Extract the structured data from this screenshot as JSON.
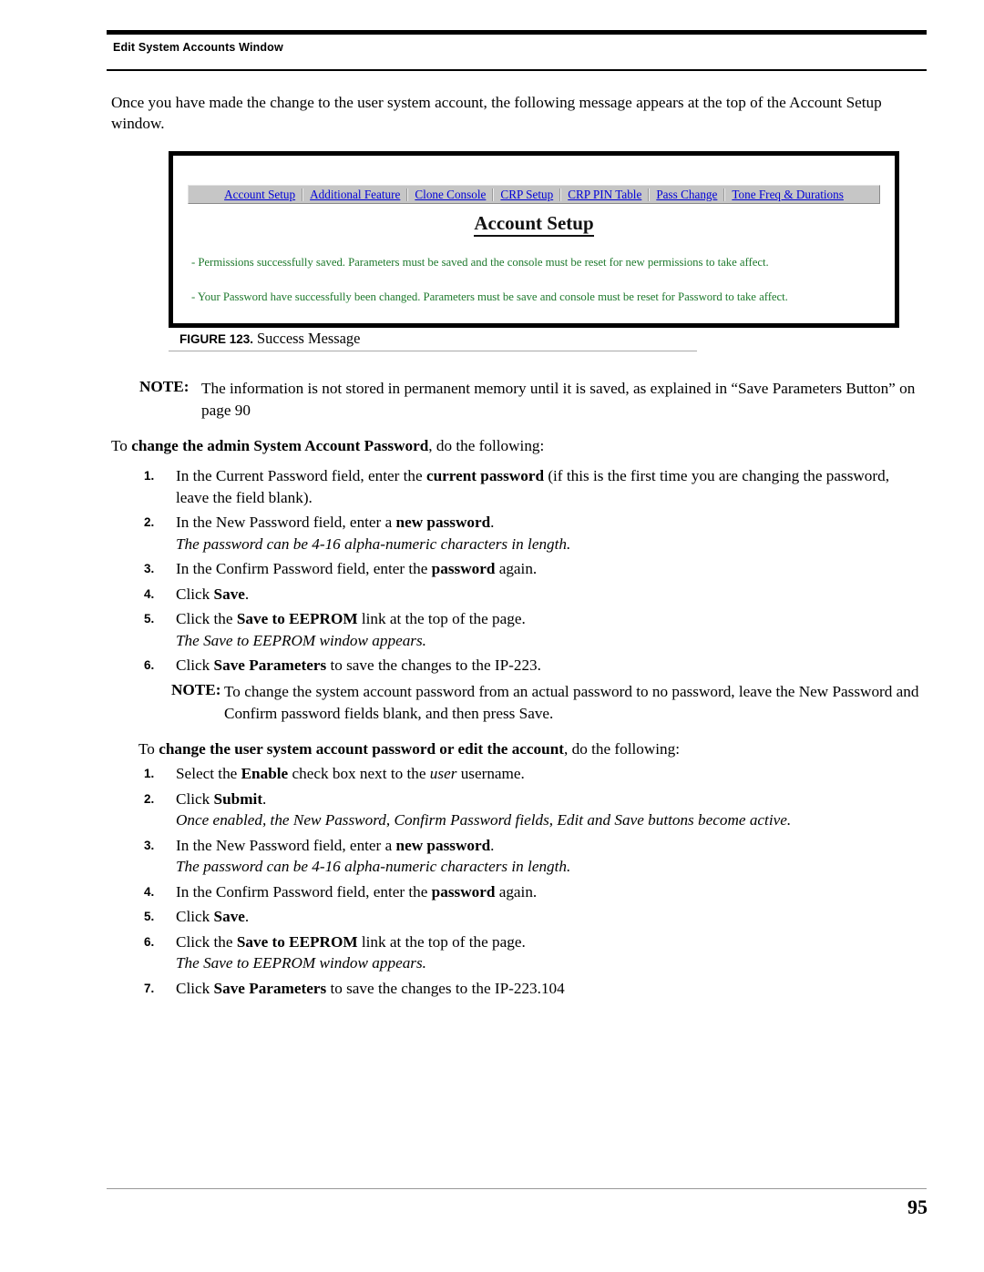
{
  "header": {
    "title": "Edit System Accounts Window"
  },
  "intro": {
    "paragraph": "Once you have made the change to the user system account, the following message appears at the top of the Account Setup window."
  },
  "figure": {
    "label": "FIGURE 123.",
    "caption": "Success Message",
    "screenshot": {
      "nav_tabs": [
        "Account Setup",
        "Additional Feature",
        "Clone Console",
        "CRP Setup",
        "CRP PIN Table",
        "Pass Change",
        "Tone Freq & Durations"
      ],
      "page_title": "Account Setup",
      "messages": [
        "- Permissions successfully saved. Parameters must be saved and the console must be reset for new permissions to take affect.",
        "- Your Password have successfully been changed. Parameters must be save and console must be reset for Password to take affect."
      ],
      "colors": {
        "link": "#0000d8",
        "toolbar_background": "#c6c6c6",
        "success_message": "#1f7a2e",
        "border": "#000000"
      }
    }
  },
  "note_1": {
    "label": "NOTE:",
    "body_part_1": "The information is not stored in permanent memory until it is saved, as explained in ",
    "body_quoted": "“Save Parameters Button”",
    "body_part_2": " on page 90"
  },
  "section_1": {
    "lead": "To ",
    "bold": "change the admin System Account Password",
    "tail": ", do the following:",
    "steps": [
      {
        "num": "1.",
        "pre": "In the Current Password field, enter the ",
        "bold": "current password",
        "post": " (if this is the first time you are changing the password, leave the field blank).",
        "sub": ""
      },
      {
        "num": "2.",
        "pre": "In the New Password field, enter a ",
        "bold": "new password",
        "post": ".",
        "sub": "The password can be 4-16 alpha-numeric characters in length."
      },
      {
        "num": "3.",
        "pre": "In the Confirm Password field, enter the ",
        "bold": "password",
        "post": " again.",
        "sub": ""
      },
      {
        "num": "4.",
        "pre": "Click ",
        "bold": "Save",
        "post": ".",
        "sub": ""
      },
      {
        "num": "5.",
        "pre": "Click the ",
        "bold": "Save to EEPROM",
        "post": " link at the top of the page.",
        "sub": "The Save to EEPROM window appears."
      },
      {
        "num": "6.",
        "pre": "Click ",
        "bold": "Save Parameters",
        "post": " to save the changes to the IP-223.",
        "sub": ""
      }
    ]
  },
  "note_2": {
    "label": "NOTE:",
    "body": "To change the system account password from an actual password to no password, leave the New Password and Confirm password fields blank, and then press Save."
  },
  "section_2": {
    "lead": "To ",
    "bold": "change the user system account password or edit the account",
    "tail": ", do the following:",
    "steps": [
      {
        "num": "1.",
        "pre": "Select the ",
        "bold": "Enable",
        "post": " check box next to the ",
        "italic": "user",
        "post2": " username.",
        "sub": ""
      },
      {
        "num": "2.",
        "pre": "Click ",
        "bold": "Submit",
        "post": ".",
        "sub": "Once enabled, the New Password, Confirm Password fields, Edit and Save buttons become active."
      },
      {
        "num": "3.",
        "pre": "In the New Password field, enter a ",
        "bold": "new password",
        "post": ".",
        "sub": "The password can be 4-16 alpha-numeric characters in length."
      },
      {
        "num": "4.",
        "pre": "In the Confirm Password field, enter the ",
        "bold": "password",
        "post": " again.",
        "sub": ""
      },
      {
        "num": "5.",
        "pre": "Click ",
        "bold": "Save",
        "post": ".",
        "sub": ""
      },
      {
        "num": "6.",
        "pre": "Click the ",
        "bold": "Save to EEPROM",
        "post": " link at the top of the page.",
        "sub": "The Save to EEPROM window appears."
      },
      {
        "num": "7.",
        "pre": "Click ",
        "bold": "Save Parameters",
        "post": " to save the changes to the IP-223.104",
        "sub": ""
      }
    ]
  },
  "footer": {
    "page_number": "95"
  }
}
